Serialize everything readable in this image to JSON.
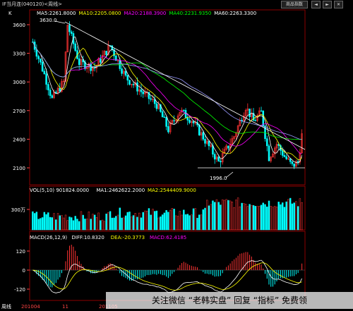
{
  "window": {
    "title": "IF当月连(040120)<周线>",
    "buttons": [
      "商品指数",
      "◄",
      "►",
      "✕"
    ]
  },
  "main_panel": {
    "indicator_prefix": "K",
    "ma": [
      {
        "label": "MA5:2261.8000",
        "color": "#ffffff"
      },
      {
        "label": "MA10:2205.0800",
        "color": "#ffff00"
      },
      {
        "label": "MA20:2188.3900",
        "color": "#ff00ff"
      },
      {
        "label": "MA40:2231.9350",
        "color": "#00ff00"
      },
      {
        "label": "MA60:2263.3300",
        "color": "#ffffff"
      }
    ],
    "y_ticks": [
      "3600",
      "3300",
      "3000",
      "2700",
      "2400",
      "2100"
    ],
    "annotations": {
      "high": "3630.0",
      "low": "1996.0"
    }
  },
  "volume_panel": {
    "header": [
      "VOL(5,10) 901824.0000",
      "MA1:2462622.2000",
      "MA2:2544409.9000"
    ],
    "header_colors": [
      "#ffffff",
      "#ffffff",
      "#ffff00"
    ],
    "y_tick": "300万"
  },
  "macd_panel": {
    "header": [
      "MACD(26,12,9)",
      "DIFF:10.8320",
      "DEA:-20.3773",
      "MACD:62.4185"
    ],
    "header_colors": [
      "#ffffff",
      "#ffffff",
      "#ffff00",
      "#ff00ff"
    ],
    "y_ticks": [
      "120",
      "0",
      "-120"
    ]
  },
  "x_axis": {
    "labels": [
      "周线",
      "201004",
      "11",
      "201105"
    ]
  },
  "watermark": {
    "text": "关注微信 “老韩实盘” 回复 “指标” 免费领"
  },
  "colors": {
    "up": "#ff3333",
    "down": "#00ffff",
    "grid": "#8b0000",
    "axis_text": "#ff4444",
    "trendline": "#ffffff"
  }
}
